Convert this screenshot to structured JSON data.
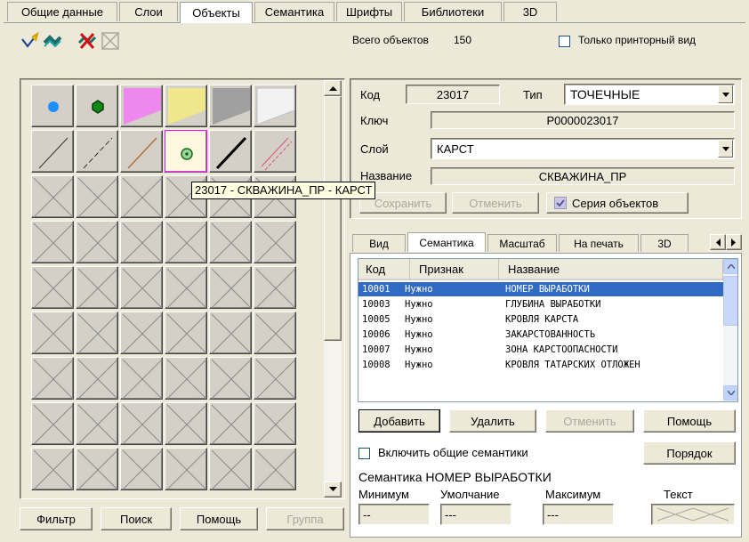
{
  "main_tabs": [
    {
      "label": "Общие данные",
      "active": false
    },
    {
      "label": "Слои",
      "active": false
    },
    {
      "label": "Объекты",
      "active": true
    },
    {
      "label": "Семантика",
      "active": false
    },
    {
      "label": "Шрифты",
      "active": false
    },
    {
      "label": "Библиотеки",
      "active": false
    },
    {
      "label": "3D",
      "active": false
    }
  ],
  "toolbar": {
    "icons": [
      "edit-object-icon",
      "link-objects-icon",
      "delete-object-icon",
      "clear-icon"
    ]
  },
  "total_label": "Всего объектов",
  "total_value": "150",
  "print_only_label": "Только принторный вид",
  "code_label": "Код",
  "code_value": "23017",
  "type_label": "Тип",
  "type_value": "ТОЧЕЧНЫЕ",
  "key_label": "Ключ",
  "key_value": "P0000023017",
  "layer_label": "Слой",
  "layer_value": "КАРСТ",
  "name_label": "Название",
  "name_value": "СКВАЖИНА_ПР",
  "tooltip": "23017 - СКВАЖИНА_ПР - КАРСТ",
  "save_label": "Сохранить",
  "cancel_label": "Отменить",
  "series_label": "Серия объектов",
  "sub_tabs": [
    {
      "label": "Вид",
      "active": false
    },
    {
      "label": "Семантика",
      "active": true
    },
    {
      "label": "Масштаб",
      "active": false
    },
    {
      "label": "На печать",
      "active": false
    },
    {
      "label": "3D",
      "active": false
    }
  ],
  "table": {
    "headers": [
      "Код",
      "Признак",
      "Название"
    ],
    "rows": [
      {
        "code": "10001",
        "flag": "Нужно",
        "name": "НОМЕР ВЫРАБОТКИ",
        "selected": true
      },
      {
        "code": "10003",
        "flag": "Нужно",
        "name": "ГЛУБИНА ВЫРАБОТКИ",
        "selected": false
      },
      {
        "code": "10005",
        "flag": "Нужно",
        "name": "КРОВЛЯ КАРСТА",
        "selected": false
      },
      {
        "code": "10006",
        "flag": "Нужно",
        "name": "ЗАКАРСТОВАННОСТЬ",
        "selected": false
      },
      {
        "code": "10007",
        "flag": "Нужно",
        "name": "ЗОНА КАРСТООПАСНОСТИ",
        "selected": false
      },
      {
        "code": "10008",
        "flag": "Нужно",
        "name": "КРОВЛЯ ТАТАРСКИХ ОТЛОЖЕН",
        "selected": false
      }
    ]
  },
  "add_label": "Добавить",
  "delete_label": "Удалить",
  "cancel2_label": "Отменить",
  "help_label": "Помощь",
  "include_common_label": "Включить общие семантики",
  "order_label": "Порядок",
  "semantic_caption": "Семантика НОМЕР ВЫРАБОТКИ",
  "min_label": "Минимум",
  "default_label": "Умолчание",
  "max_label": "Максимум",
  "text_label": "Текст",
  "min_value": "--",
  "default_value": "---",
  "max_value": "---",
  "filter_label": "Фильтр",
  "search_label": "Поиск",
  "help2_label": "Помощь",
  "group_label": "Группа",
  "colors": {
    "selection": "#316ac5",
    "window_bg": "#ece9d8",
    "highlight_border": "#ff00ff"
  }
}
